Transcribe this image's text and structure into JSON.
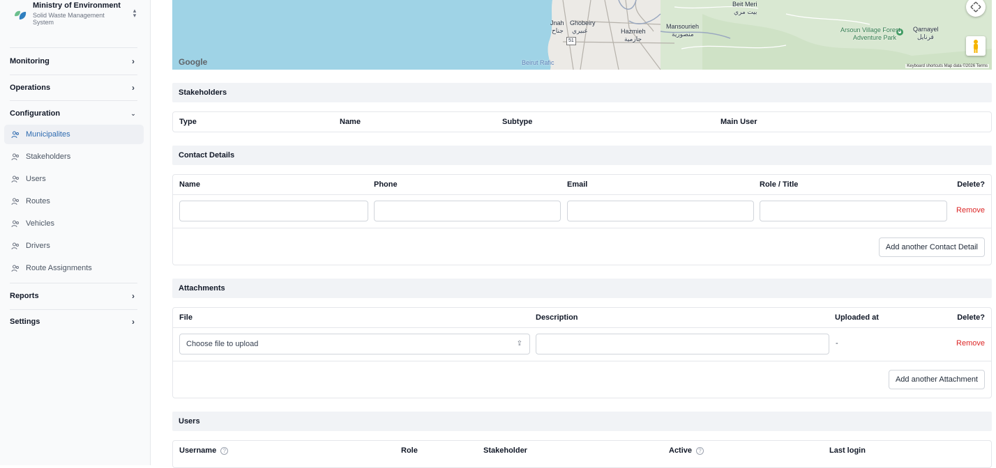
{
  "sidebar": {
    "title": "Ministry of Environment",
    "subtitle": "Solid Waste Management System",
    "groups": {
      "monitoring": "Monitoring",
      "operations": "Operations",
      "configuration": "Configuration",
      "reports": "Reports",
      "settings": "Settings"
    },
    "items": [
      {
        "label": "Municipalites",
        "active": true
      },
      {
        "label": "Stakeholders"
      },
      {
        "label": "Users"
      },
      {
        "label": "Routes"
      },
      {
        "label": "Vehicles"
      },
      {
        "label": "Drivers"
      },
      {
        "label": "Route Assignments"
      }
    ]
  },
  "map": {
    "labels": {
      "beit_meri": "Beit Meri",
      "beit_meri_ar": "بيت مري",
      "jnah": "Jnah",
      "ghobeiry": "Ghobeiry",
      "jnah_ar": "جناح",
      "ghobeiry_ar": "غبيري",
      "hazmieh": "Hazmieh",
      "hazmieh_ar": "حازمية",
      "mansourieh": "Mansourieh",
      "mansourieh_ar": "منصورية",
      "arsoun": "Arsoun Village Forest",
      "adventure": "Adventure Park",
      "qarnayel": "Qarnayel",
      "qarnayel_ar": "قرنايل",
      "beirut_rafic": "Beirut Rafic",
      "road_51": "51"
    },
    "google": "Google",
    "footer": "Keyboard shortcuts   Map data ©2026   Terms"
  },
  "stakeholders": {
    "title": "Stakeholders",
    "columns": [
      "Type",
      "Name",
      "Subtype",
      "Main User"
    ]
  },
  "contacts": {
    "title": "Contact Details",
    "columns": [
      "Name",
      "Phone",
      "Email",
      "Role / Title",
      "Delete?"
    ],
    "remove": "Remove",
    "add_button": "Add another Contact Detail"
  },
  "attachments": {
    "title": "Attachments",
    "columns": [
      "File",
      "Description",
      "Uploaded at",
      "Delete?"
    ],
    "file_placeholder": "Choose file to upload",
    "uploaded_at": "-",
    "remove": "Remove",
    "add_button": "Add another Attachment"
  },
  "users": {
    "title": "Users",
    "columns": [
      "Username",
      "Role",
      "Stakeholder",
      "Active",
      "Last login"
    ]
  },
  "colors": {
    "accent": "#2e6bb0",
    "danger": "#dc2626",
    "sea": "#9fd3e6",
    "land": "#e6efe3"
  }
}
